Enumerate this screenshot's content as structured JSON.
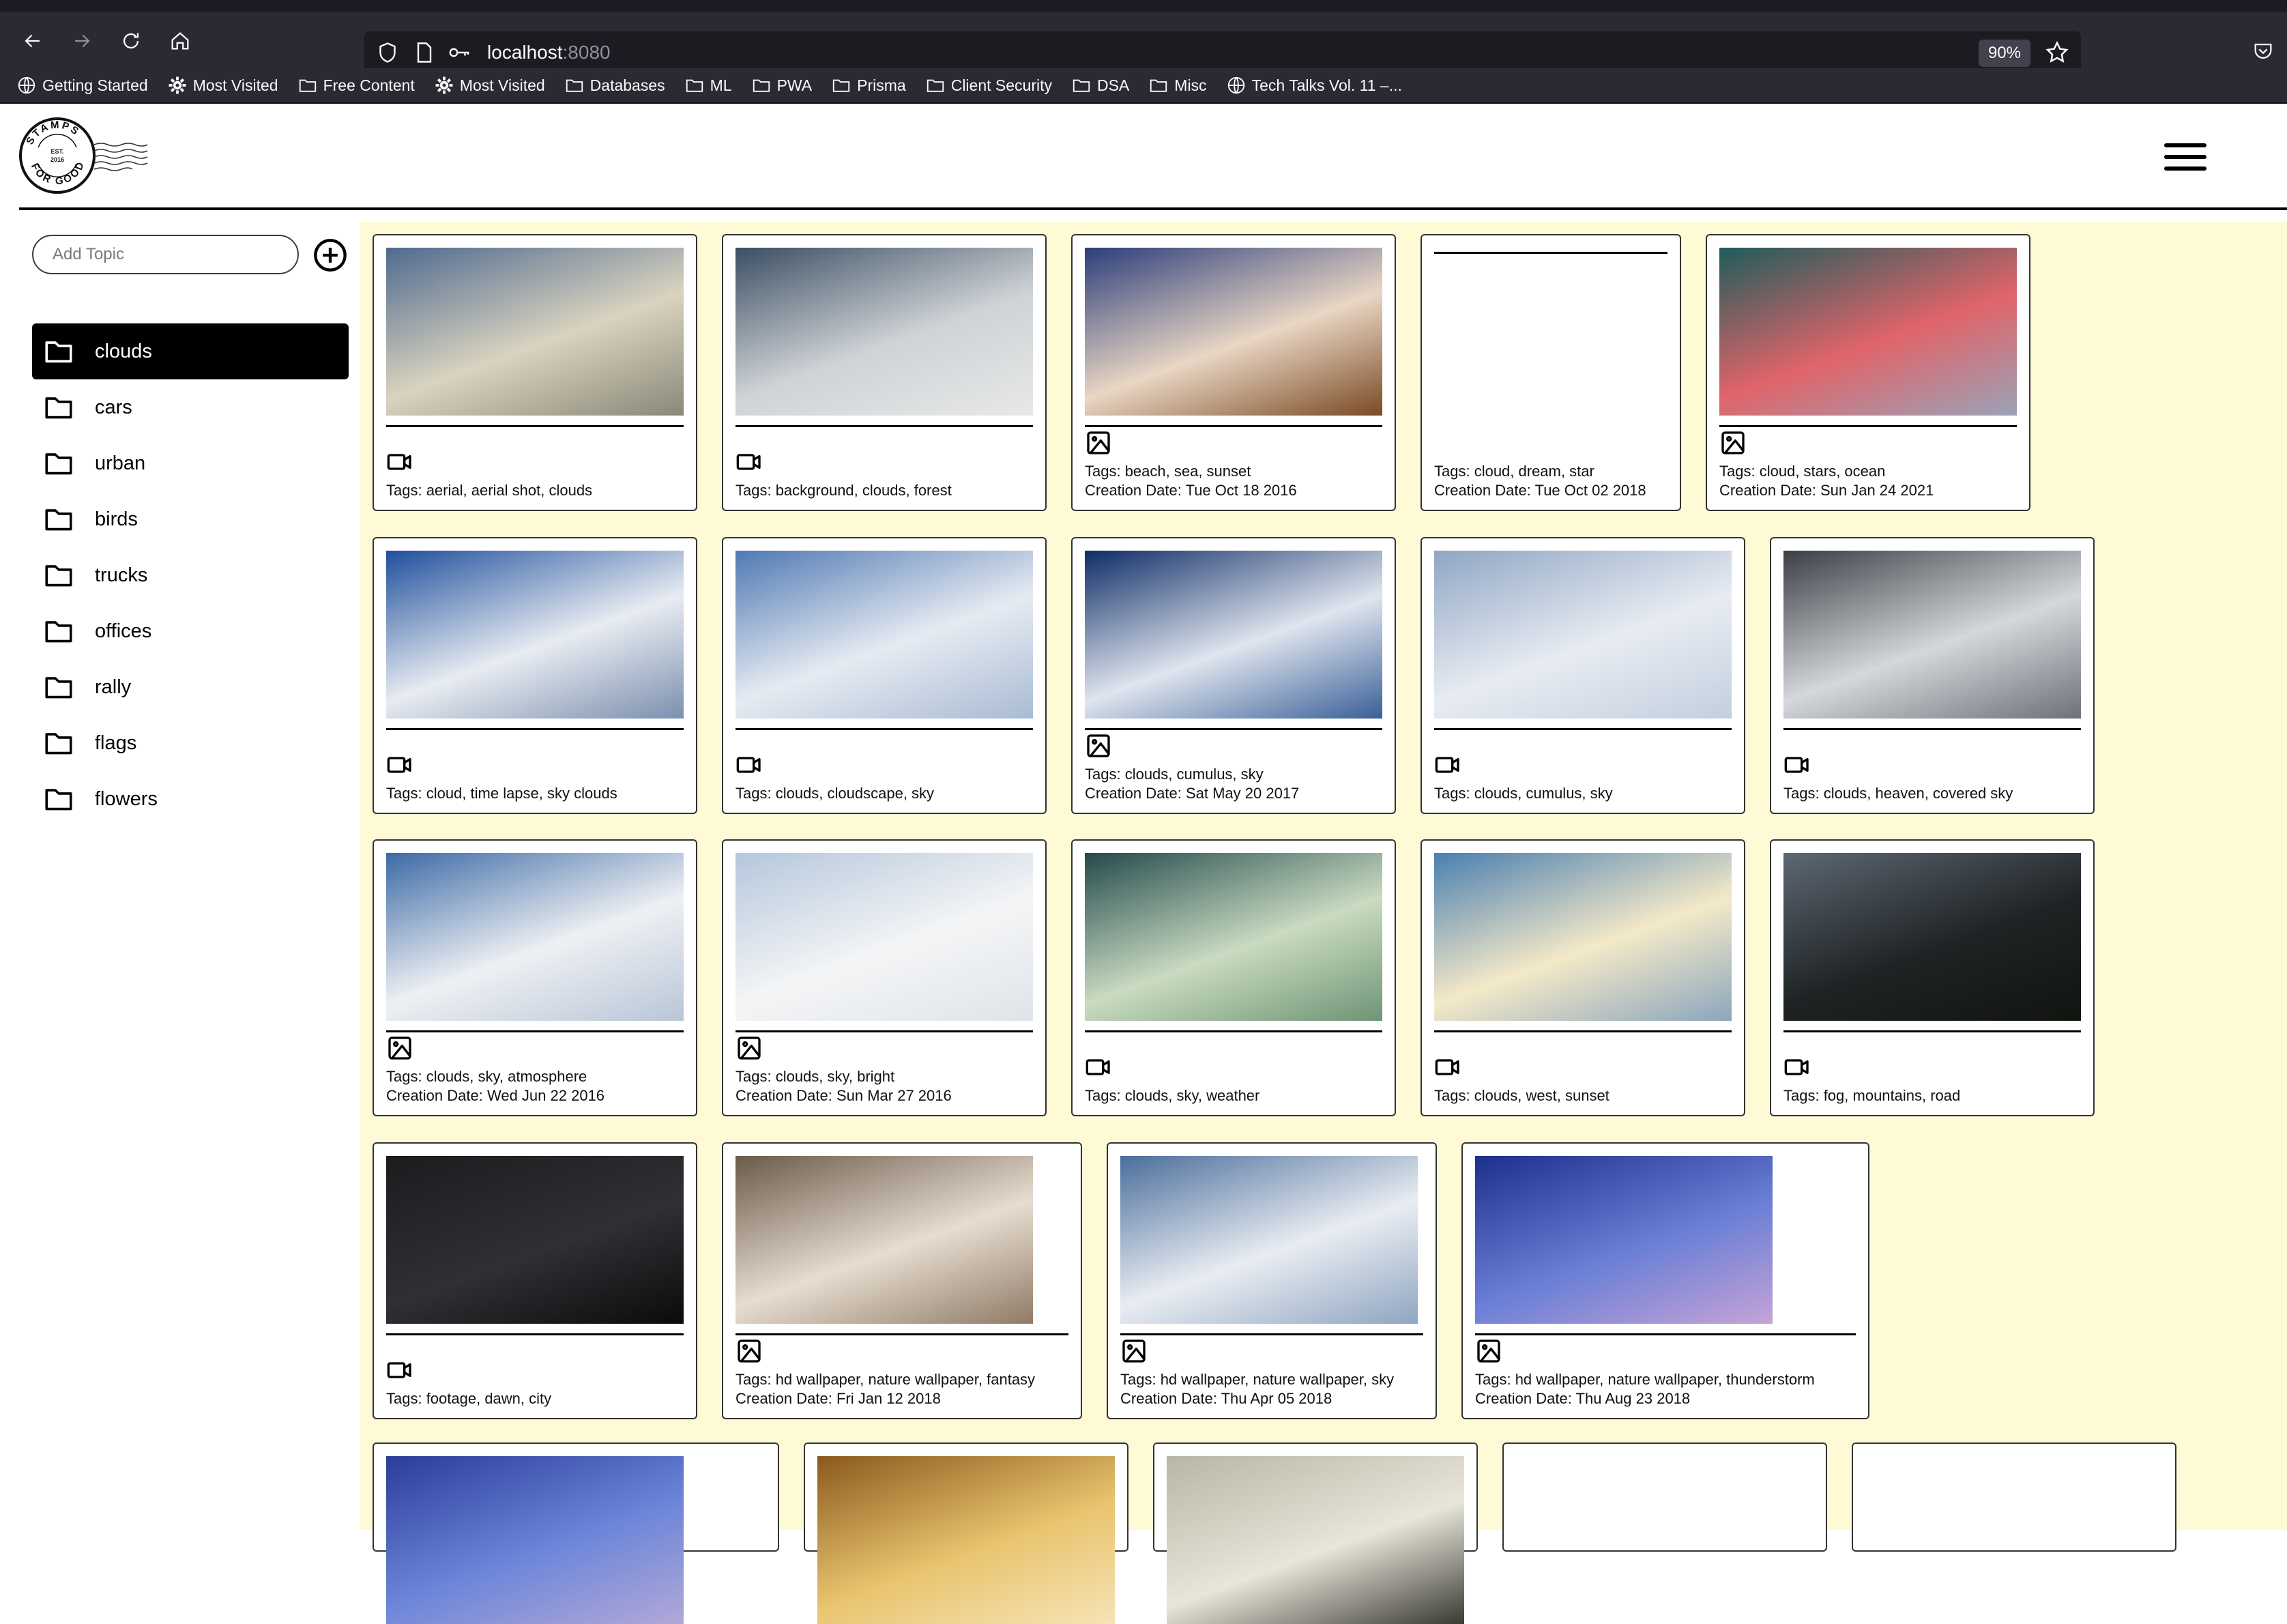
{
  "browser": {
    "url_host": "localhost",
    "url_port": ":8080",
    "zoom_level": "90%",
    "bookmarks": [
      {
        "icon": "globe-icon",
        "label": "Getting Started"
      },
      {
        "icon": "gear-icon",
        "label": "Most Visited"
      },
      {
        "icon": "folder-icon",
        "label": "Free Content"
      },
      {
        "icon": "gear-icon",
        "label": "Most Visited"
      },
      {
        "icon": "folder-icon",
        "label": "Databases"
      },
      {
        "icon": "folder-icon",
        "label": "ML"
      },
      {
        "icon": "folder-icon",
        "label": "PWA"
      },
      {
        "icon": "folder-icon",
        "label": "Prisma"
      },
      {
        "icon": "folder-icon",
        "label": "Client Security"
      },
      {
        "icon": "folder-icon",
        "label": "DSA"
      },
      {
        "icon": "folder-icon",
        "label": "Misc"
      },
      {
        "icon": "globe-icon",
        "label": "Tech Talks Vol. 11 –..."
      }
    ]
  },
  "header": {
    "logo": {
      "top_text": "STAMPS",
      "bottom_text": "FOR GOOD",
      "center_line1": "EST.",
      "center_line2": "2016"
    }
  },
  "sidebar": {
    "add_topic_placeholder": "Add Topic",
    "add_topic_value": "",
    "topics": [
      {
        "label": "clouds",
        "active": true
      },
      {
        "label": "cars",
        "active": false
      },
      {
        "label": "urban",
        "active": false
      },
      {
        "label": "birds",
        "active": false
      },
      {
        "label": "trucks",
        "active": false
      },
      {
        "label": "offices",
        "active": false
      },
      {
        "label": "rally",
        "active": false
      },
      {
        "label": "flags",
        "active": false
      },
      {
        "label": "flowers",
        "active": false
      }
    ]
  },
  "colors": {
    "main_background": "#fffad6",
    "chrome_background": "#2b2a33",
    "active_topic": "#000000"
  },
  "gallery": {
    "rows": [
      [
        {
          "type": "video",
          "tags": "Tags: aerial, aerial shot, clouds",
          "date": "",
          "thumb": [
            "#4f6a8f",
            "#d9d3bf",
            "#8b8878"
          ]
        },
        {
          "type": "video",
          "tags": "Tags: background, clouds, forest",
          "date": "",
          "thumb": [
            "#3b4e63",
            "#cfd3d6",
            "#e7e8e8"
          ]
        },
        {
          "type": "image",
          "tags": "Tags: beach, sea, sunset",
          "date": "Creation Date: Tue Oct 18 2016",
          "thumb": [
            "#2b3d7a",
            "#e9d6c4",
            "#7a4a23"
          ]
        },
        {
          "type": "none",
          "tags": "Tags: cloud, dream, star",
          "date": "Creation Date: Tue Oct 02 2018",
          "thumb": []
        },
        {
          "type": "image",
          "tags": "Tags: cloud, stars, ocean",
          "date": "Creation Date: Sun Jan 24 2021",
          "thumb": [
            "#1f5c5a",
            "#e0646a",
            "#9aa3b7"
          ]
        }
      ],
      [
        {
          "type": "video",
          "tags": "Tags: cloud, time lapse, sky clouds",
          "date": "",
          "thumb": [
            "#1f4f9c",
            "#e8ecf2",
            "#7b8fae"
          ]
        },
        {
          "type": "video",
          "tags": "Tags: clouds, cloudscape, sky",
          "date": "",
          "thumb": [
            "#5079b3",
            "#e6ebf2",
            "#a9bbd4"
          ]
        },
        {
          "type": "image",
          "tags": "Tags: clouds, cumulus, sky",
          "date": "Creation Date: Sat May 20 2017",
          "thumb": [
            "#0e2c66",
            "#dfe5ee",
            "#3a5f98"
          ]
        },
        {
          "type": "video",
          "tags": "Tags: clouds, cumulus, sky",
          "date": "",
          "thumb": [
            "#8fa6c4",
            "#e8ecf2",
            "#c3cfdf"
          ]
        },
        {
          "type": "video",
          "tags": "Tags: clouds, heaven, covered sky",
          "date": "",
          "thumb": [
            "#3b3f45",
            "#d4d8dc",
            "#6d7178"
          ]
        }
      ],
      [
        {
          "type": "image",
          "tags": "Tags: clouds, sky, atmosphere",
          "date": "Creation Date: Wed Jun 22 2016",
          "thumb": [
            "#3c6aa6",
            "#eef0f3",
            "#b9c6d8"
          ]
        },
        {
          "type": "image",
          "tags": "Tags: clouds, sky, bright",
          "date": "Creation Date: Sun Mar 27 2016",
          "thumb": [
            "#b5c7dc",
            "#f4f5f6",
            "#dfe4ea"
          ]
        },
        {
          "type": "video",
          "tags": "Tags: clouds, sky, weather",
          "date": "",
          "thumb": [
            "#244a4c",
            "#c9dbc1",
            "#6f9475"
          ]
        },
        {
          "type": "video",
          "tags": "Tags: clouds, west, sunset",
          "date": "",
          "thumb": [
            "#4a7fb0",
            "#f4e9c8",
            "#8ba6bd"
          ]
        },
        {
          "type": "video",
          "tags": "Tags: fog, mountains, road",
          "date": "",
          "thumb": [
            "#5d6874",
            "#1f2324",
            "#11140f"
          ]
        }
      ],
      [
        {
          "type": "video",
          "tags": "Tags: footage, dawn, city",
          "date": "",
          "thumb": [
            "#1a1c1e",
            "#2e3033",
            "#0a0b0c"
          ]
        },
        {
          "type": "image",
          "tags": "Tags: hd wallpaper, nature wallpaper, fantasy",
          "date": "Creation Date: Fri Jan 12 2018",
          "thumb": [
            "#6a5a4a",
            "#e7ddd0",
            "#8f7b67"
          ]
        },
        {
          "type": "image",
          "tags": "Tags: hd wallpaper, nature wallpaper, sky",
          "date": "Creation Date: Thu Apr 05 2018",
          "thumb": [
            "#4b6e9c",
            "#e9edf2",
            "#8fa5c1"
          ]
        },
        {
          "type": "image",
          "tags": "Tags: hd wallpaper, nature wallpaper, thunderstorm",
          "date": "Creation Date: Thu Aug 23 2018",
          "thumb": [
            "#1d2f8c",
            "#6a7fd6",
            "#c6a3d6"
          ]
        }
      ],
      [
        {
          "type": "partial",
          "tags": "",
          "date": "",
          "thumb": [
            "#2a3d9a",
            "#6d86d9",
            "#b1a8d8"
          ]
        },
        {
          "type": "partial",
          "tags": "",
          "date": "",
          "thumb": [
            "#8a5a1c",
            "#e9c46f",
            "#f6e3b5"
          ]
        },
        {
          "type": "partial",
          "tags": "",
          "date": "",
          "thumb": [
            "#b9b6a6",
            "#e8e5d9",
            "#3a3a33"
          ]
        },
        {
          "type": "partial-empty",
          "tags": "",
          "date": "",
          "thumb": []
        },
        {
          "type": "partial-empty",
          "tags": "",
          "date": "",
          "thumb": []
        }
      ]
    ]
  }
}
